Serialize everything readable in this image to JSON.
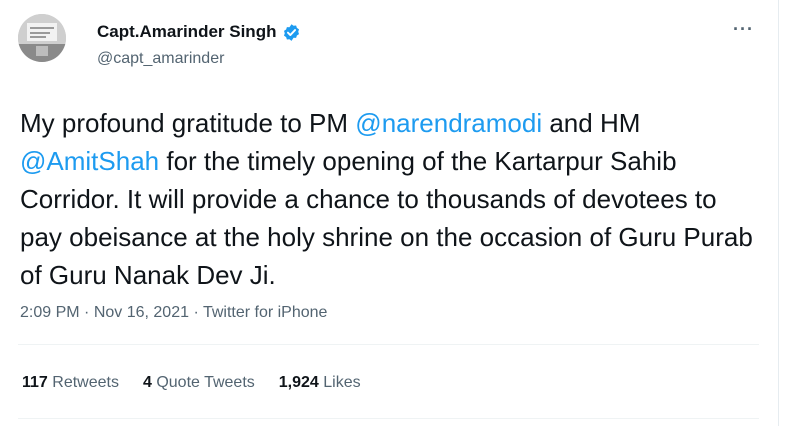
{
  "tweet": {
    "display_name": "Capt.Amarinder Singh",
    "handle": "@capt_amarinder",
    "more_glyph": "···",
    "text_parts": {
      "t1": "My profound gratitude to PM ",
      "m1": "@narendramodi",
      "t2": " and HM ",
      "m2": "@AmitShah",
      "t3": " for the timely opening of the Kartarpur Sahib Corridor. It will provide a chance to thousands of devotees to pay obeisance at the holy shrine on the occasion of Guru Purab of Guru Nanak Dev Ji."
    },
    "time": "2:09 PM",
    "date": "Nov 16, 2021",
    "separator": " · ",
    "source": "Twitter for iPhone",
    "stats": {
      "retweets_count": "117",
      "retweets_label": "Retweets",
      "quotes_count": "4",
      "quotes_label": "Quote Tweets",
      "likes_count": "1,924",
      "likes_label": "Likes"
    }
  },
  "colors": {
    "accent": "#1d9bf0",
    "text": "#0f1419",
    "secondary": "#536471"
  },
  "icons": {
    "verified": "verified-badge-icon",
    "more": "more-options-icon"
  }
}
